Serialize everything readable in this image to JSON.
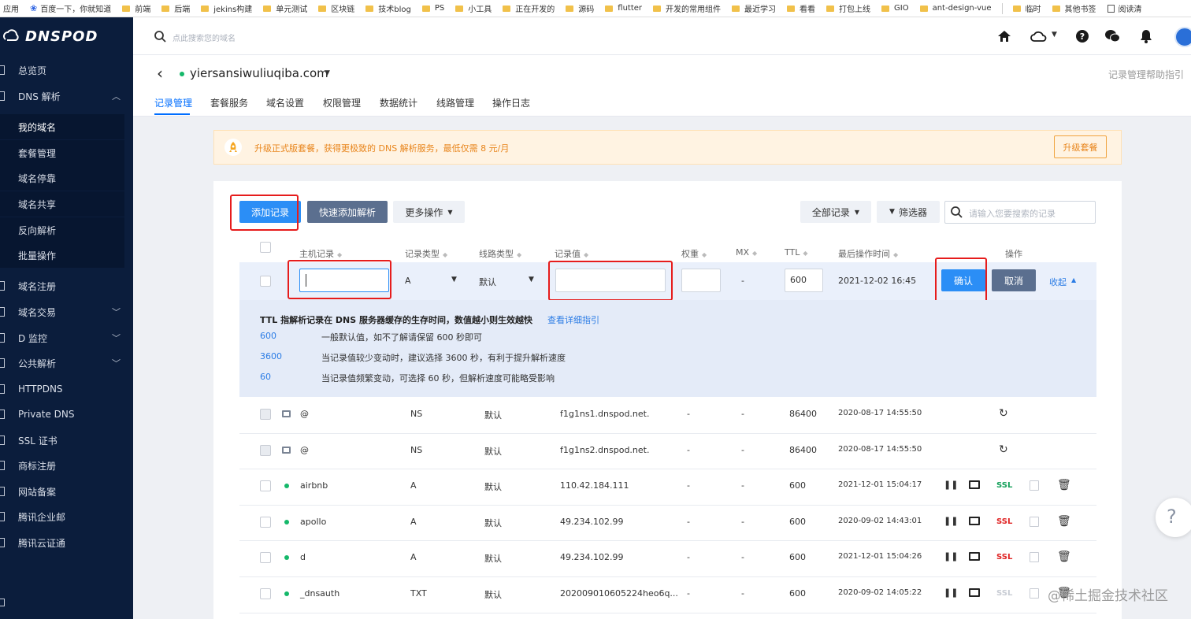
{
  "bookmarks": [
    {
      "label": "应用",
      "type": "apps"
    },
    {
      "label": "百度一下，你就知道",
      "type": "baidu"
    },
    {
      "label": "前端",
      "type": "folder"
    },
    {
      "label": "后端",
      "type": "folder"
    },
    {
      "label": "jekins构建",
      "type": "folder"
    },
    {
      "label": "单元测试",
      "type": "folder"
    },
    {
      "label": "区块链",
      "type": "folder"
    },
    {
      "label": "技术blog",
      "type": "folder"
    },
    {
      "label": "PS",
      "type": "folder"
    },
    {
      "label": "小工具",
      "type": "folder"
    },
    {
      "label": "正在开发的",
      "type": "folder"
    },
    {
      "label": "源码",
      "type": "folder"
    },
    {
      "label": "flutter",
      "type": "folder"
    },
    {
      "label": "开发的常用组件",
      "type": "folder"
    },
    {
      "label": "最近学习",
      "type": "folder"
    },
    {
      "label": "看看",
      "type": "folder"
    },
    {
      "label": "打包上线",
      "type": "folder"
    },
    {
      "label": "GIO",
      "type": "folder"
    },
    {
      "label": "ant-design-vue",
      "type": "folder"
    },
    {
      "label": "临时",
      "type": "folder"
    },
    {
      "label": "其他书签",
      "type": "folder"
    },
    {
      "label": "阅读清",
      "type": "reading"
    }
  ],
  "logo": {
    "text": "DNSPOD"
  },
  "sidebar": {
    "items": [
      {
        "label": "总览页"
      },
      {
        "label": "DNS 解析",
        "chevron": "up"
      },
      {
        "label": "我的域名",
        "sub": true,
        "active": true
      },
      {
        "label": "套餐管理",
        "sub": true
      },
      {
        "label": "域名停靠",
        "sub": true
      },
      {
        "label": "域名共享",
        "sub": true
      },
      {
        "label": "反向解析",
        "sub": true
      },
      {
        "label": "批量操作",
        "sub": true
      },
      {
        "label": "域名注册"
      },
      {
        "label": "域名交易",
        "chevron": "down"
      },
      {
        "label": "D 监控",
        "chevron": "down"
      },
      {
        "label": "公共解析",
        "chevron": "down"
      },
      {
        "label": "HTTPDNS"
      },
      {
        "label": "Private DNS"
      },
      {
        "label": "SSL 证书"
      },
      {
        "label": "商标注册"
      },
      {
        "label": "网站备案"
      },
      {
        "label": "腾讯企业邮"
      },
      {
        "label": "腾讯云证通"
      }
    ]
  },
  "topbar": {
    "search_placeholder": "点此搜索您的域名",
    "icons": [
      "home-icon",
      "cloud-icon",
      "help-icon",
      "wechat-icon",
      "bell-icon",
      "avatar"
    ]
  },
  "domain": {
    "name": "yiersansiwuliuqiba.com",
    "help_link": "记录管理帮助指引",
    "tabs": [
      "记录管理",
      "套餐服务",
      "域名设置",
      "权限管理",
      "数据统计",
      "线路管理",
      "操作日志"
    ]
  },
  "banner": {
    "text": "升级正式版套餐，获得更极致的 DNS 解析服务，最低仅需 8 元/月",
    "button": "升级套餐"
  },
  "toolbar": {
    "add_record": "添加记录",
    "quick_add": "快速添加解析",
    "more_ops": "更多操作",
    "all_records": "全部记录",
    "filter": "筛选器",
    "search_placeholder": "请输入您要搜索的记录"
  },
  "table": {
    "headers": [
      "主机记录",
      "记录类型",
      "线路类型",
      "记录值",
      "权重",
      "MX",
      "TTL",
      "最后操作时间",
      "操作"
    ],
    "edit_row": {
      "host": "",
      "type": "A",
      "line": "默认",
      "value": "",
      "weight": "",
      "mx": "-",
      "ttl": "600",
      "time": "2021-12-02 16:45",
      "confirm": "确认",
      "cancel": "取消",
      "collapse": "收起"
    },
    "help": {
      "title": "TTL 指解析记录在 DNS 服务器缓存的生存时间，数值越小则生效越快",
      "link": "查看详细指引",
      "lines": [
        {
          "value": "600",
          "desc": "一般默认值，如不了解请保留 600 秒即可"
        },
        {
          "value": "3600",
          "desc": "当记录值较少变动时，建议选择 3600 秒，有利于提升解析速度"
        },
        {
          "value": "60",
          "desc": "当记录值频繁变动，可选择 60 秒，但解析速度可能略受影响"
        }
      ]
    },
    "rows": [
      {
        "host": "@",
        "type": "NS",
        "line": "默认",
        "value": "f1g1ns1.dnspod.net.",
        "weight": "-",
        "mx": "-",
        "ttl": "86400",
        "time": "2020-08-17 14:55:50",
        "kind": "system"
      },
      {
        "host": "@",
        "type": "NS",
        "line": "默认",
        "value": "f1g1ns2.dnspod.net.",
        "weight": "-",
        "mx": "-",
        "ttl": "86400",
        "time": "2020-08-17 14:55:50",
        "kind": "system"
      },
      {
        "host": "airbnb",
        "type": "A",
        "line": "默认",
        "value": "110.42.184.111",
        "weight": "-",
        "mx": "-",
        "ttl": "600",
        "time": "2021-12-01 15:04:17",
        "kind": "user",
        "ssl_color": "#14a05a"
      },
      {
        "host": "apollo",
        "type": "A",
        "line": "默认",
        "value": "49.234.102.99",
        "weight": "-",
        "mx": "-",
        "ttl": "600",
        "time": "2020-09-02 14:43:01",
        "kind": "user",
        "ssl_color": "#e02424"
      },
      {
        "host": "d",
        "type": "A",
        "line": "默认",
        "value": "49.234.102.99",
        "weight": "-",
        "mx": "-",
        "ttl": "600",
        "time": "2021-12-01 15:04:26",
        "kind": "user",
        "ssl_color": "#e02424"
      },
      {
        "host": "_dnsauth",
        "type": "TXT",
        "line": "默认",
        "value": "202009010605224heo6q...",
        "weight": "-",
        "mx": "-",
        "ttl": "600",
        "time": "2020-09-02 14:05:22",
        "kind": "user",
        "ssl_color": "#c8ccd4"
      }
    ]
  },
  "ssl_label": "SSL",
  "watermark": "@稀土掘金技术社区",
  "float_help": "?",
  "colors": {
    "accent": "#006eff",
    "sidebar": "#0b1d3c",
    "primary_btn": "#2b8ef6",
    "annotation_red": "#e61c1c",
    "status_green": "#15b86a"
  }
}
